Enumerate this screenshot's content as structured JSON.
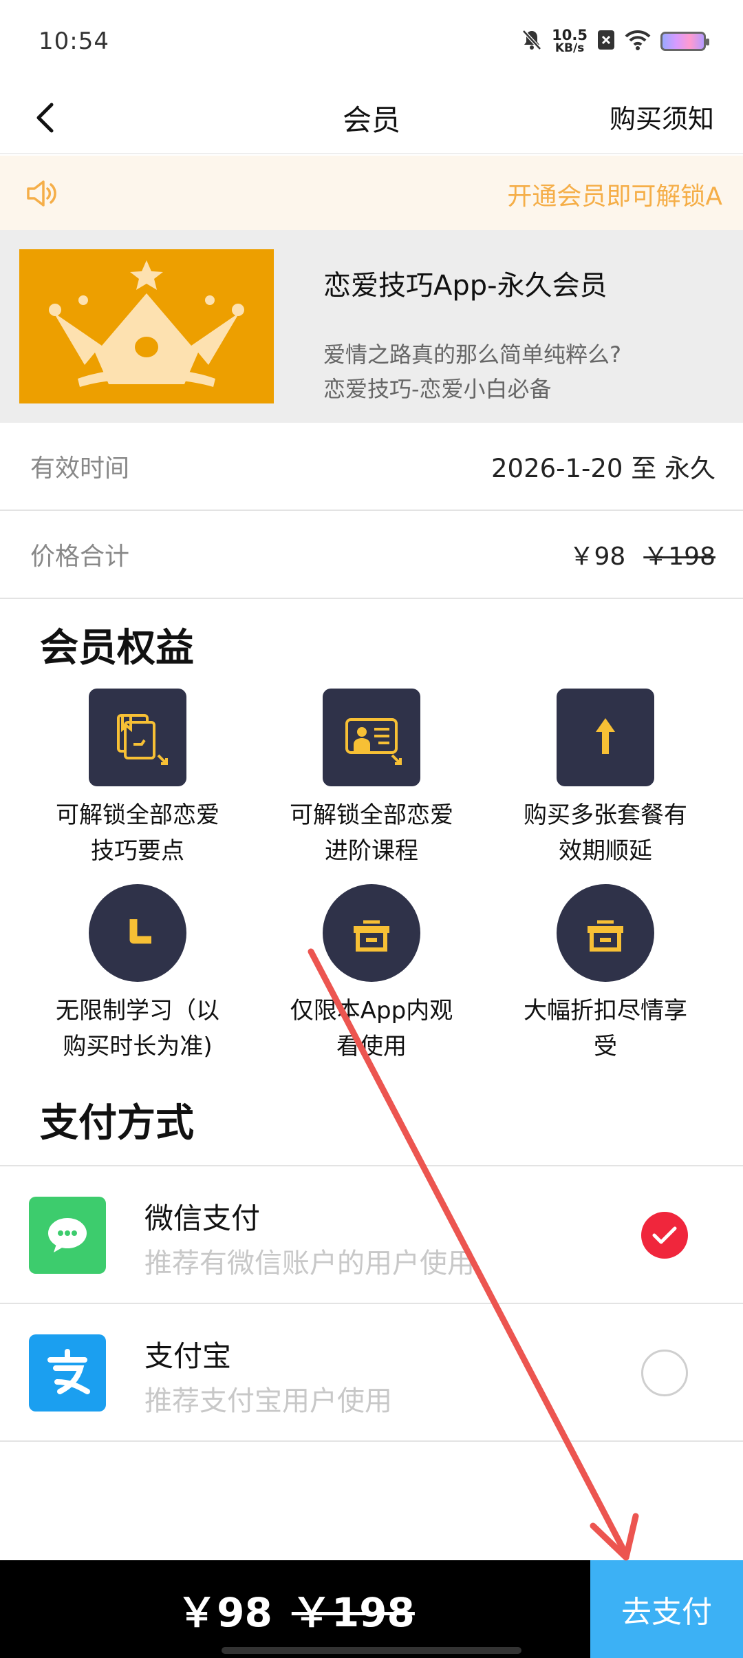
{
  "status_bar": {
    "time": "10:54",
    "net_speed_value": "10.5",
    "net_speed_unit": "KB/s"
  },
  "nav": {
    "title": "会员",
    "right_link": "购买须知"
  },
  "notice": {
    "text": "开通会员即可解锁A"
  },
  "product": {
    "title": "恋爱技巧App-永久会员",
    "desc_line1": "爱情之路真的那么简单纯粹么?",
    "desc_line2": "恋爱技巧-恋爱小白必备"
  },
  "validity": {
    "label": "有效时间",
    "value": "2026-1-20 至 永久"
  },
  "price": {
    "label": "价格合计",
    "current": "￥98",
    "original": "￥198"
  },
  "benefits": {
    "title": "会员权益",
    "items": [
      {
        "line1": "可解锁全部恋爱",
        "line2": "技巧要点"
      },
      {
        "line1": "可解锁全部恋爱",
        "line2": "进阶课程"
      },
      {
        "line1": "购买多张套餐有",
        "line2": "效期顺延"
      },
      {
        "line1": "无限制学习（以",
        "line2": "购买时长为准)"
      },
      {
        "line1": "仅限本App内观",
        "line2": "看使用"
      },
      {
        "line1": "大幅折扣尽情享",
        "line2": "受"
      }
    ]
  },
  "payment": {
    "title": "支付方式",
    "methods": [
      {
        "name": "微信支付",
        "subtitle": "推荐有微信账户的用户使用",
        "selected": true,
        "color": "#3dcc6d"
      },
      {
        "name": "支付宝",
        "subtitle": "推荐支付宝用户使用",
        "selected": false,
        "color": "#1b9ff0"
      }
    ]
  },
  "bottom_bar": {
    "price": "￥98",
    "original_price": "￥198",
    "pay_button": "去支付",
    "button_color": "#3cb1f5"
  },
  "colors": {
    "accent_orange": "#f5ae48",
    "crown_bg": "#ed9f00",
    "icon_bg": "#2f3249",
    "icon_fg": "#f7c035",
    "check_red": "#f0263c"
  }
}
